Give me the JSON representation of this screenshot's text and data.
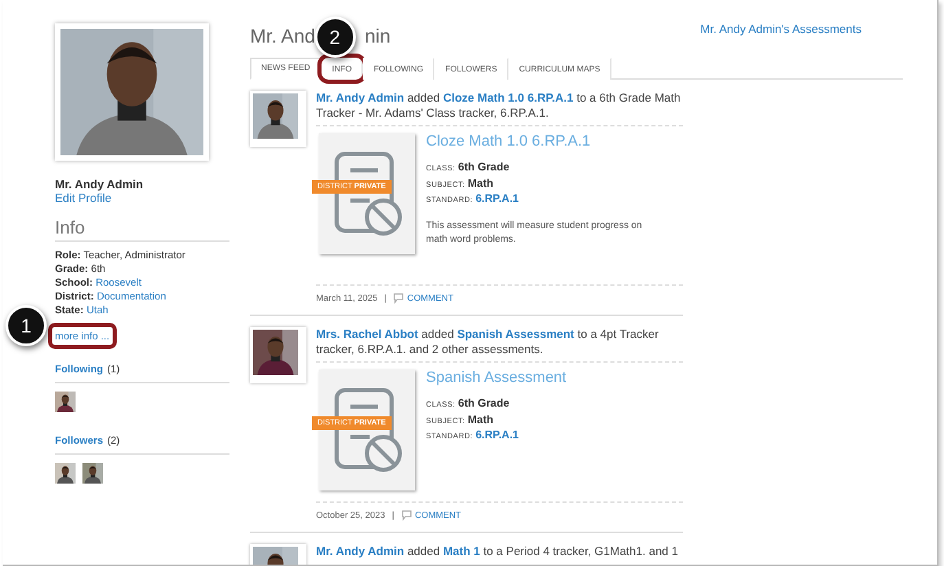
{
  "profile": {
    "name": "Mr. Andy Admin",
    "edit_link": "Edit Profile"
  },
  "info": {
    "heading": "Info",
    "fields": [
      {
        "label": "Role:",
        "value": "Teacher, Administrator",
        "kind": "text"
      },
      {
        "label": "Grade:",
        "value": "6th",
        "kind": "text"
      },
      {
        "label": "School:",
        "value": "Roosevelt",
        "kind": "link"
      },
      {
        "label": "District:",
        "value": "Documentation",
        "kind": "link"
      },
      {
        "label": "State:",
        "value": "Utah",
        "kind": "link"
      }
    ],
    "more_link": {
      "label": "more info ...",
      "highlighted": true,
      "callout": "1"
    }
  },
  "following": {
    "label": "Following",
    "count": "(1)"
  },
  "followers": {
    "label": "Followers",
    "count": "(2)"
  },
  "page_title_parts": [
    "Mr. And",
    "nin"
  ],
  "assessments_link": "Mr. Andy Admin's Assessments",
  "tabs": [
    {
      "label": "NEWS FEED",
      "selected": true,
      "highlighted": false
    },
    {
      "label": "INFO",
      "selected": false,
      "highlighted": true,
      "callout": "2"
    },
    {
      "label": "FOLLOWING",
      "selected": false,
      "highlighted": false
    },
    {
      "label": "FOLLOWERS",
      "selected": false,
      "highlighted": false
    },
    {
      "label": "CURRICULUM MAPS",
      "selected": false,
      "highlighted": false
    }
  ],
  "feed": [
    {
      "sentence": [
        {
          "text": "Mr. Andy Admin",
          "kind": "link"
        },
        {
          "text": " added ",
          "kind": "text"
        },
        {
          "text": "Cloze Math 1.0 6.RP.A.1",
          "kind": "link"
        },
        {
          "text": " to a 6th Grade Math Tracker - Mr. Adams' Class tracker, 6.RP.A.1.",
          "kind": "text"
        }
      ],
      "card": {
        "badge": "DISTRICT **PRIVATE**",
        "title": "Cloze Math 1.0 6.RP.A.1",
        "meta": [
          {
            "label": "CLASS:",
            "value": "6th Grade",
            "kind": "text"
          },
          {
            "label": "SUBJECT:",
            "value": "Math",
            "kind": "text"
          },
          {
            "label": "STANDARD:",
            "value": "6.RP.A.1",
            "kind": "link"
          }
        ],
        "description": "This assessment will measure student progress on math word problems."
      },
      "date": "March 11, 2025",
      "separator": "|",
      "comment": "COMMENT"
    },
    {
      "sentence": [
        {
          "text": "Mrs. Rachel Abbot",
          "kind": "link"
        },
        {
          "text": " added ",
          "kind": "text"
        },
        {
          "text": "Spanish Assessment",
          "kind": "link"
        },
        {
          "text": " to a 4pt Tracker tracker, 6.RP.A.1. and 2 other assessments.",
          "kind": "text"
        }
      ],
      "card": {
        "badge": "DISTRICT **PRIVATE**",
        "title": "Spanish Assessment",
        "meta": [
          {
            "label": "CLASS:",
            "value": "6th Grade",
            "kind": "text"
          },
          {
            "label": "SUBJECT:",
            "value": "Math",
            "kind": "text"
          },
          {
            "label": "STANDARD:",
            "value": "6.RP.A.1",
            "kind": "link"
          }
        ]
      },
      "date": "October 25, 2023",
      "separator": "|",
      "comment": "COMMENT"
    },
    {
      "sentence": [
        {
          "text": "Mr. Andy Admin",
          "kind": "link"
        },
        {
          "text": " added ",
          "kind": "text"
        },
        {
          "text": "Math 1",
          "kind": "link"
        },
        {
          "text": " to a Period 4 tracker, G1Math1. and 1",
          "kind": "text"
        }
      ]
    }
  ]
}
